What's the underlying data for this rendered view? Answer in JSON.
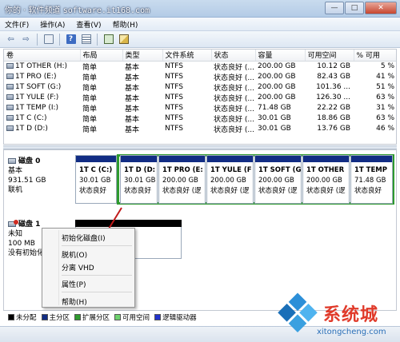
{
  "window": {
    "title_cn": "你的 · 软件频道",
    "title_url": "software.it168.com",
    "btn_min": "—",
    "btn_max": "□",
    "btn_close": "✕"
  },
  "menu": [
    "文件(F)",
    "操作(A)",
    "查看(V)",
    "帮助(H)"
  ],
  "toolbar": {
    "back": "⇦",
    "forward": "⇨"
  },
  "volumes": {
    "columns": [
      "卷",
      "布局",
      "类型",
      "文件系统",
      "状态",
      "容量",
      "可用空间",
      "% 可用"
    ],
    "rows": [
      [
        "1T OTHER (H:)",
        "简单",
        "基本",
        "NTFS",
        "状态良好 (...",
        "200.00 GB",
        "10.12 GB",
        "5 %"
      ],
      [
        "1T PRO (E:)",
        "简单",
        "基本",
        "NTFS",
        "状态良好 (...",
        "200.00 GB",
        "82.43 GB",
        "41 %"
      ],
      [
        "1T SOFT (G:)",
        "简单",
        "基本",
        "NTFS",
        "状态良好 (...",
        "200.00 GB",
        "101.36 ...",
        "51 %"
      ],
      [
        "1T YULE (F:)",
        "简单",
        "基本",
        "NTFS",
        "状态良好 (...",
        "200.00 GB",
        "126.30 ...",
        "63 %"
      ],
      [
        "1T TEMP (I:)",
        "简单",
        "基本",
        "NTFS",
        "状态良好 (...",
        "71.48 GB",
        "22.22 GB",
        "31 %"
      ],
      [
        "1T C (C:)",
        "简单",
        "基本",
        "NTFS",
        "状态良好 (...",
        "30.01 GB",
        "18.86 GB",
        "63 %"
      ],
      [
        "1T D (D:)",
        "简单",
        "基本",
        "NTFS",
        "状态良好 (...",
        "30.01 GB",
        "13.76 GB",
        "46 %"
      ]
    ]
  },
  "disk0": {
    "name": "磁盘 0",
    "type": "基本",
    "size": "931.51 GB",
    "status": "联机",
    "partitions": [
      {
        "name": "1T C (C:)",
        "size": "30.01 GB",
        "status": "状态良好"
      },
      {
        "name": "1T D (D:",
        "size": "30.01 GB",
        "status": "状态良好"
      },
      {
        "name": "1T PRO (E:",
        "size": "200.00 GB",
        "status": "状态良好 (逻"
      },
      {
        "name": "1T YULE (F",
        "size": "200.00 GB",
        "status": "状态良好 (逻"
      },
      {
        "name": "1T SOFT (G",
        "size": "200.00 GB",
        "status": "状态良好 (逻"
      },
      {
        "name": "1T OTHER",
        "size": "200.00 GB",
        "status": "状态良好 (逻"
      },
      {
        "name": "1T TEMP",
        "size": "71.48 GB",
        "status": "状态良好"
      }
    ]
  },
  "disk1": {
    "name": "磁盘 1",
    "type": "未知",
    "size": "100 MB",
    "status": "没有初始化"
  },
  "context_menu": {
    "init": "初始化磁盘(I)",
    "offline": "脱机(O)",
    "detach": "分离 VHD",
    "properties": "属性(P)",
    "help": "帮助(H)"
  },
  "legend": [
    {
      "label": "未分配",
      "color": "#000000"
    },
    {
      "label": "主分区",
      "color": "#122d84"
    },
    {
      "label": "扩展分区",
      "color": "#2e9a2e"
    },
    {
      "label": "可用空间",
      "color": "#6ed26e"
    },
    {
      "label": "逻辑驱动器",
      "color": "#2233cc"
    }
  ],
  "watermark": {
    "brand": "系统城",
    "site": "xitongcheng.com"
  }
}
